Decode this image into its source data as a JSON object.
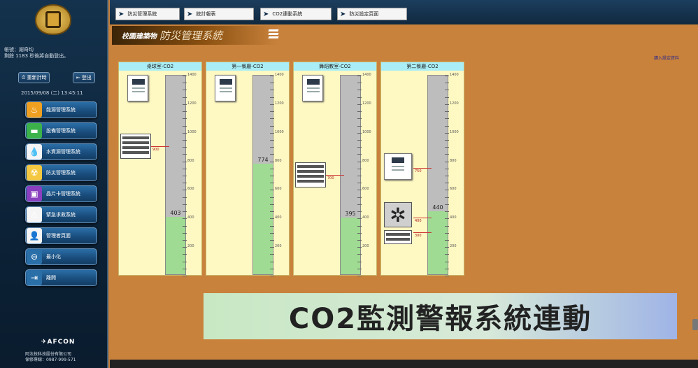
{
  "sidebar": {
    "user_line1": "帳號：謝奇均",
    "user_line2": "剩餘 1183 秒後將自動登出。",
    "reset_label": "重新計時",
    "logout_label": "登出",
    "datetime": "2015/09/08 (二) 13:45:11",
    "menu": [
      {
        "label": "能源管理系統",
        "icon": "energy-icon",
        "glyph": "♨",
        "bg": "#f0a020"
      },
      {
        "label": "設備管理系統",
        "icon": "equipment-icon",
        "glyph": "▬",
        "bg": "#3cb34a"
      },
      {
        "label": "水資源管理系統",
        "icon": "water-icon",
        "glyph": "💧",
        "bg": "#f5f5f5"
      },
      {
        "label": "防災管理系統",
        "icon": "radiation-icon",
        "glyph": "☢",
        "bg": "#f5c842"
      },
      {
        "label": "晶片卡管理系統",
        "icon": "card-icon",
        "glyph": "▣",
        "bg": "#8a3fbf"
      },
      {
        "label": "緊急求救系統",
        "icon": "warning-icon",
        "glyph": "⚠",
        "bg": "#f5f5f5"
      },
      {
        "label": "管理者頁面",
        "icon": "admin-icon",
        "glyph": "👤",
        "bg": "#f5f5f5"
      },
      {
        "label": "最小化",
        "icon": "minimize-icon",
        "glyph": "⊖",
        "bg": "#2b6fa8"
      },
      {
        "label": "離開",
        "icon": "exit-icon",
        "glyph": "⇥",
        "bg": "#2b6fa8"
      }
    ],
    "brand": "AFCON",
    "company_line1": "阿法技科技股份有限公司",
    "company_line2": "保修專線：0987-999-571"
  },
  "nav": [
    "防災管理系統",
    "統計報表",
    "CO2連動系統",
    "防災設定頁面"
  ],
  "header": {
    "title_a": "校園建築物",
    "title_b": "防災管理系統"
  },
  "read_report": "讀入設定資料",
  "panels": [
    {
      "title": "桌球室-CO2",
      "value": "403",
      "value_num": 403,
      "thresholds": [
        {
          "label": "900",
          "v": 900
        }
      ],
      "device": "vent"
    },
    {
      "title": "第一餐廳-CO2",
      "value": "774",
      "value_num": 774,
      "thresholds": [],
      "device": "none"
    },
    {
      "title": "舞蹈教室-CO2",
      "value": "395",
      "value_num": 395,
      "thresholds": [
        {
          "label": "700",
          "v": 700
        }
      ],
      "device": "vent"
    },
    {
      "title": "第二餐廳-CO2",
      "value": "440",
      "value_num": 440,
      "thresholds": [
        {
          "label": "750",
          "v": 750
        },
        {
          "label": "400",
          "v": 400
        },
        {
          "label": "300",
          "v": 300
        }
      ],
      "device": "fan"
    }
  ],
  "gauge_ticks": [
    "1400",
    "1200",
    "1000",
    "800",
    "600",
    "400",
    "200"
  ],
  "gauge_max": 1400,
  "banner": "CO2監測警報系統連動"
}
